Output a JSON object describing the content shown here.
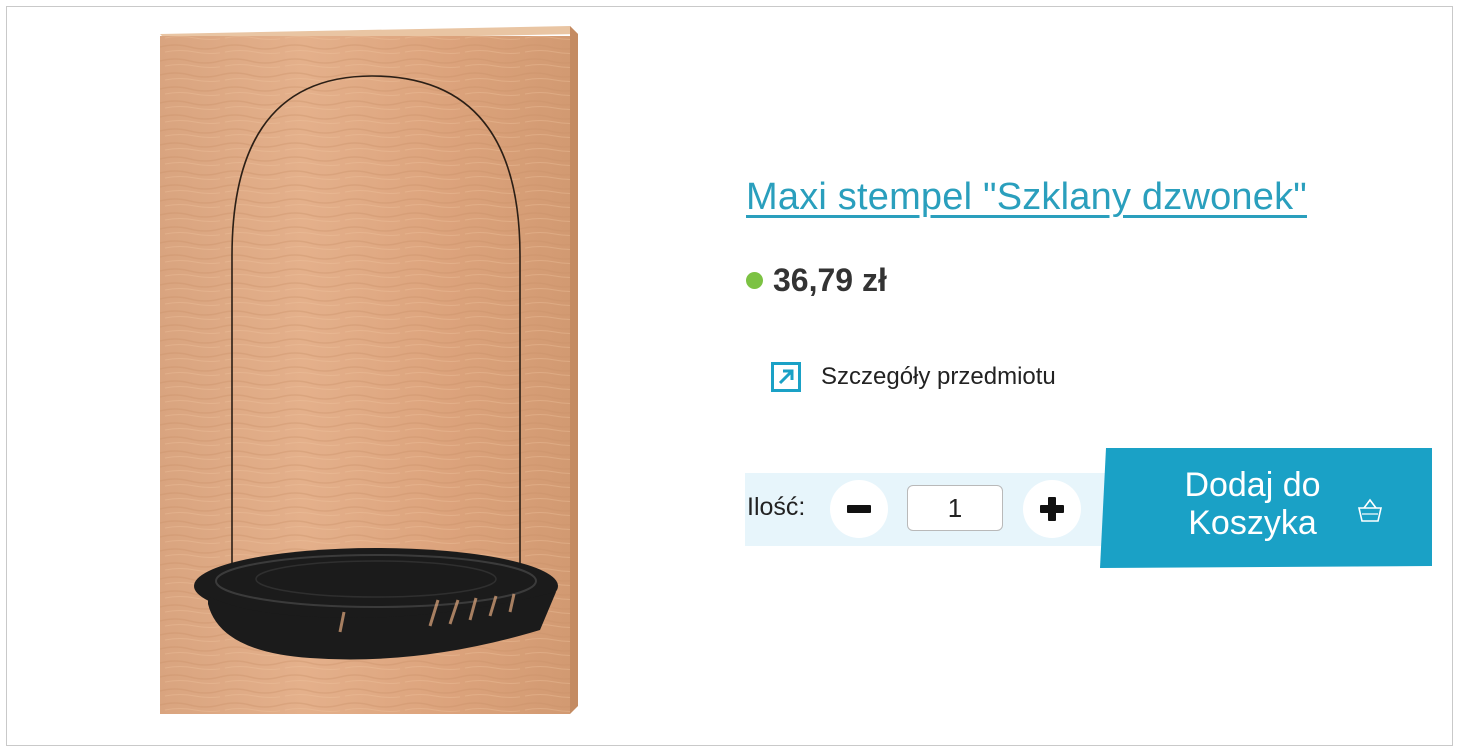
{
  "product": {
    "title": "Maxi stempel \"Szklany dzwonek\"",
    "price": "36,79 zł",
    "details_label": "Szczegóły przedmiotu",
    "image_icon": "wooden-stamp-glass-bell-image",
    "availability_color": "#7cc243"
  },
  "quantity": {
    "label": "Ilość:",
    "value": "1",
    "decrement_icon": "minus-icon",
    "increment_icon": "plus-icon"
  },
  "cart_button": {
    "label": "Dodaj do Koszyka",
    "icon": "basket-icon",
    "color": "#1aa1c6"
  },
  "colors": {
    "link": "#2a9fbd",
    "quantity_panel": "#e7f5fb",
    "accent": "#1aa1c6"
  }
}
